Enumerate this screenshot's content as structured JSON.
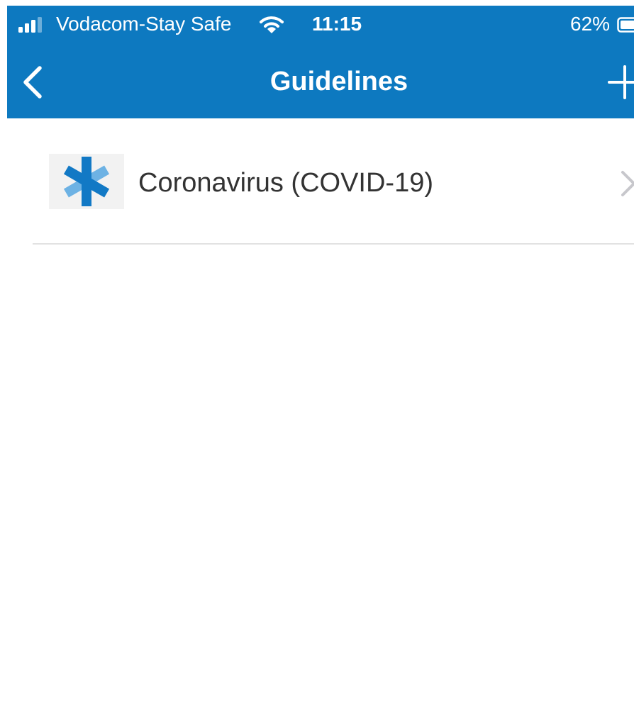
{
  "status_bar": {
    "carrier": "Vodacom-Stay Safe",
    "time": "11:15",
    "battery": "62%",
    "icons": [
      "signal-icon",
      "wifi-icon",
      "battery-icon"
    ]
  },
  "nav": {
    "title": "Guidelines",
    "back_icon": "back-chevron-icon",
    "add_icon": "plus-icon"
  },
  "list": {
    "items": [
      {
        "label": "Coronavirus (COVID-19)",
        "icon": "medical-star-icon"
      }
    ]
  },
  "colors": {
    "header": "#0d79c0",
    "icon_blue": "#1279c5",
    "icon_light": "#6db2e4",
    "divider": "#e2e2e2"
  }
}
